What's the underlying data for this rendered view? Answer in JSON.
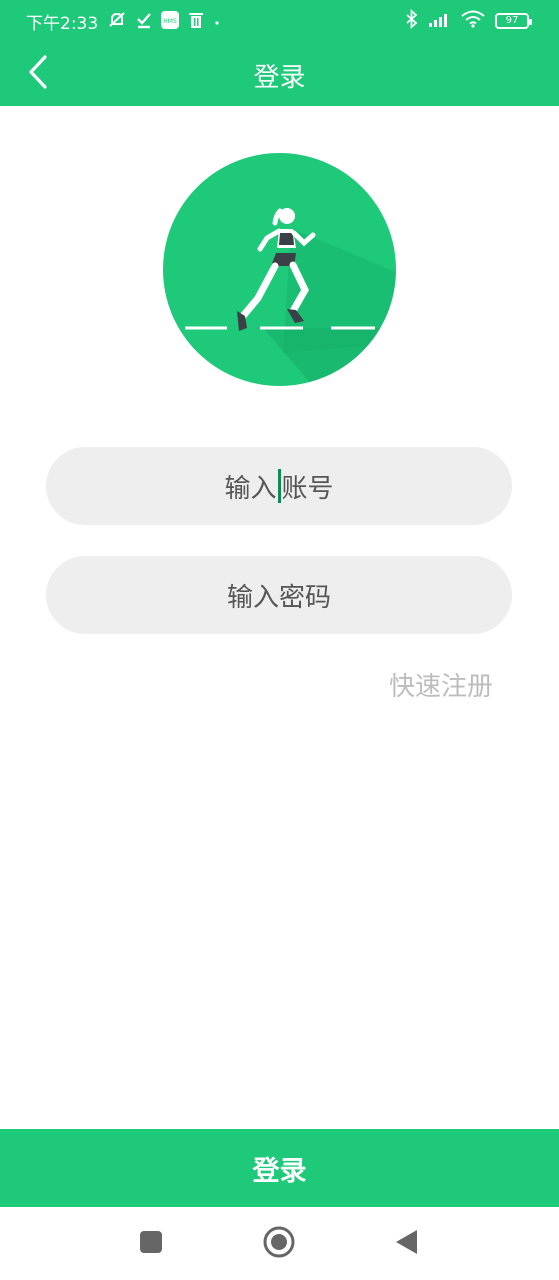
{
  "status_bar": {
    "time": "下午2:33",
    "battery": "97"
  },
  "app_bar": {
    "title": "登录"
  },
  "form": {
    "account_placeholder_left": "输入",
    "account_placeholder_right": "账号",
    "password_placeholder": "输入密码",
    "quick_register": "快速注册"
  },
  "footer": {
    "login_label": "登录"
  },
  "colors": {
    "primary": "#1ec97a",
    "input_bg": "#eeeeee",
    "caret": "#0c8b57",
    "muted_text": "#bdbdbd"
  },
  "icons": {
    "status_left": [
      "mute-bell-icon",
      "check-icon",
      "hms-icon",
      "trash-icon",
      "dot-icon"
    ],
    "status_right": [
      "bluetooth-icon",
      "signal-icon",
      "wifi-icon",
      "battery-icon"
    ],
    "back": "chevron-left-icon",
    "logo": "runner-icon",
    "nav": [
      "recent-apps-icon",
      "home-icon",
      "back-triangle-icon"
    ]
  }
}
